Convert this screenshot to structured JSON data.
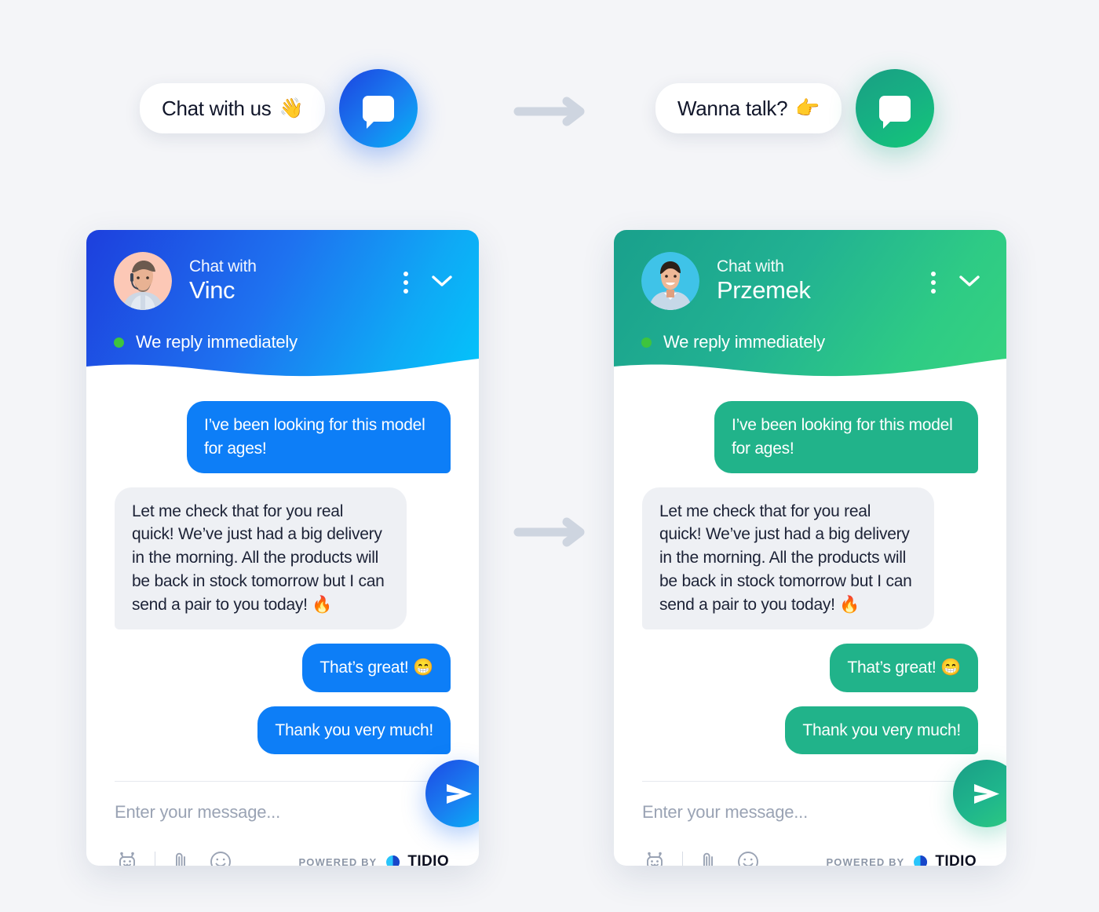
{
  "background_color": "#f4f5f8",
  "launchers": [
    {
      "id": "blue",
      "pill_text": "Chat with us",
      "pill_emoji": "👋",
      "button_icon": "chat-bubble-icon",
      "accent": "#1a7ef0"
    },
    {
      "id": "green",
      "pill_text": "Wanna talk?",
      "pill_emoji": "👉",
      "button_icon": "chat-bubble-icon",
      "accent": "#16b183"
    }
  ],
  "arrows": {
    "icon": "arrow-right-icon",
    "color": "#ced5e0"
  },
  "widgets": [
    {
      "id": "vinc",
      "accent": "#0d7ef7",
      "header": {
        "chat_with_label": "Chat with",
        "agent_name": "Vinc",
        "avatar_name": "avatar-vinc",
        "menu_icon": "kebab-menu-icon",
        "minimize_icon": "chevron-down-icon",
        "status_text": "We reply immediately",
        "status_color": "#3ec43e"
      },
      "messages": [
        {
          "direction": "out",
          "text": "I’ve been looking for this model for ages!"
        },
        {
          "direction": "in",
          "text": "Let me check that for you real quick! We’ve just had a big delivery in the morning. All the products will be back in stock tomorrow but I can send a pair to you today! 🔥"
        },
        {
          "direction": "out",
          "text": "That’s great! 😁"
        },
        {
          "direction": "out",
          "text": "Thank you very much!"
        }
      ],
      "composer": {
        "placeholder": "Enter your message...",
        "value": "",
        "tools": [
          {
            "name": "bot-icon",
            "label": "Bot"
          },
          {
            "name": "paperclip-icon",
            "label": "Attach file"
          },
          {
            "name": "emoji-icon",
            "label": "Emoji"
          }
        ],
        "send_icon": "send-icon",
        "powered_by_text": "POWERED BY",
        "brand": "TIDIO",
        "brand_logo": "tidio-logo-icon"
      }
    },
    {
      "id": "przemek",
      "accent": "#21b38a",
      "header": {
        "chat_with_label": "Chat with",
        "agent_name": "Przemek",
        "avatar_name": "avatar-przemek",
        "menu_icon": "kebab-menu-icon",
        "minimize_icon": "chevron-down-icon",
        "status_text": "We reply immediately",
        "status_color": "#3ec43e"
      },
      "messages": [
        {
          "direction": "out",
          "text": "I’ve been looking for this model for ages!"
        },
        {
          "direction": "in",
          "text": "Let me check that for you real quick! We’ve just had a big delivery in the morning. All the products will be back in stock tomorrow but I can send a pair to you today! 🔥"
        },
        {
          "direction": "out",
          "text": "That’s great! 😁"
        },
        {
          "direction": "out",
          "text": "Thank you very much!"
        }
      ],
      "composer": {
        "placeholder": "Enter your message...",
        "value": "",
        "tools": [
          {
            "name": "bot-icon",
            "label": "Bot"
          },
          {
            "name": "paperclip-icon",
            "label": "Attach file"
          },
          {
            "name": "emoji-icon",
            "label": "Emoji"
          }
        ],
        "send_icon": "send-icon",
        "powered_by_text": "POWERED BY",
        "brand": "TIDIO",
        "brand_logo": "tidio-logo-icon"
      }
    }
  ]
}
